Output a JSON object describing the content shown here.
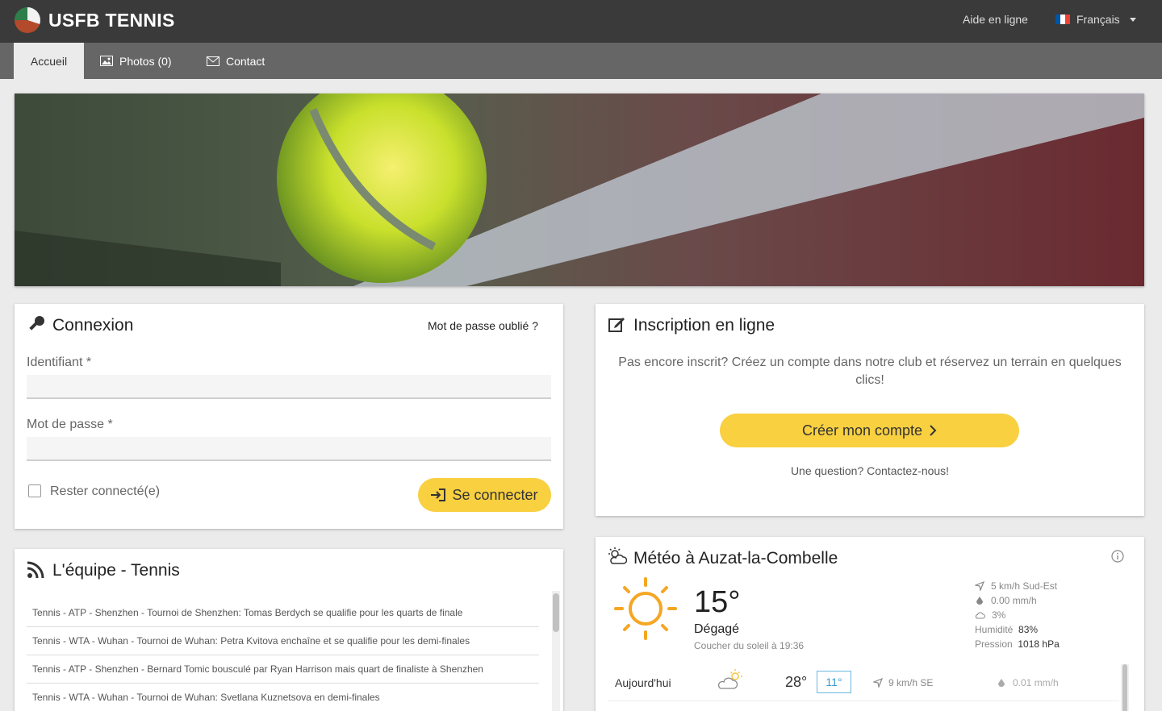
{
  "header": {
    "brand": "USFB TENNIS",
    "help_link": "Aide en ligne",
    "language": "Français"
  },
  "nav": {
    "tabs": [
      {
        "label": "Accueil"
      },
      {
        "label": "Photos (0)"
      },
      {
        "label": "Contact"
      }
    ]
  },
  "login": {
    "title": "Connexion",
    "forgot_link": "Mot de passe oublié ?",
    "username_label": "Identifiant *",
    "username_value": "",
    "password_label": "Mot de passe *",
    "password_value": "",
    "remember_label": "Rester connecté(e)",
    "remember_checked": false,
    "submit_label": "Se connecter"
  },
  "signup": {
    "title": "Inscription en ligne",
    "text": "Pas encore inscrit? Créez un compte dans notre club et réservez un terrain en quelques clics!",
    "button_label": "Créer mon compte",
    "contact_text": "Une question? Contactez-nous!"
  },
  "feed": {
    "title": "L'équipe - Tennis",
    "items": [
      "Tennis - ATP - Shenzhen - Tournoi de Shenzhen: Tomas Berdych se qualifie pour les quarts de finale",
      "Tennis - WTA - Wuhan - Tournoi de Wuhan: Petra Kvitova enchaîne et se qualifie pour les demi-finales",
      "Tennis - ATP - Shenzhen - Bernard Tomic bousculé par Ryan Harrison mais quart de finaliste à Shenzhen",
      "Tennis - WTA - Wuhan - Tournoi de Wuhan: Svetlana Kuznetsova en demi-finales"
    ]
  },
  "weather": {
    "title": "Météo à Auzat-la-Combelle",
    "temperature": "15°",
    "condition": "Dégagé",
    "sunset": "Coucher du soleil à 19:36",
    "wind": "5 km/h Sud-Est",
    "rain": "0.00 mm/h",
    "clouds": "3%",
    "humidity_label": "Humidité",
    "humidity_value": "83%",
    "pressure_label": "Pression",
    "pressure_value": "1018 hPa",
    "forecast": [
      {
        "day": "Aujourd'hui",
        "max": "28°",
        "min": "11°",
        "wind": "9 km/h SE",
        "rain": "0.01 mm/h"
      }
    ]
  },
  "colors": {
    "accent_yellow": "#f8d040",
    "topbar": "#3a3a3a",
    "navbar": "#666666",
    "sun": "#f5a623"
  }
}
